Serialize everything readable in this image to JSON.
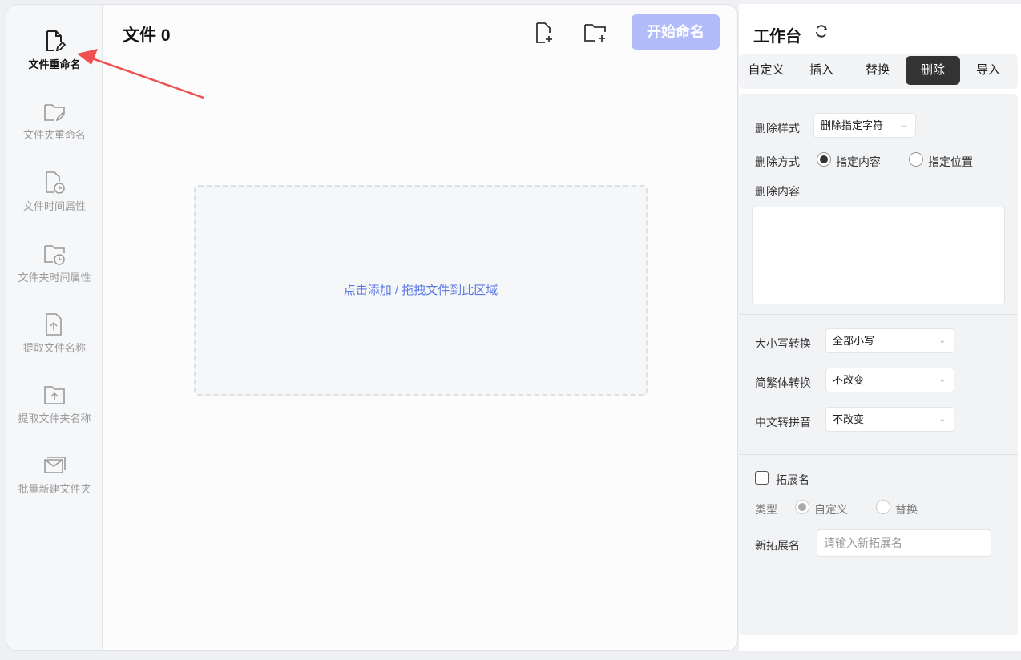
{
  "sidebar": {
    "items": [
      {
        "label": "文件重命名",
        "icon": "file-edit-icon",
        "active": true
      },
      {
        "label": "文件夹重命名",
        "icon": "folder-edit-icon"
      },
      {
        "label": "文件时间属性",
        "icon": "file-clock-icon"
      },
      {
        "label": "文件夹时间属性",
        "icon": "folder-clock-icon"
      },
      {
        "label": "提取文件名称",
        "icon": "file-upload-icon"
      },
      {
        "label": "提取文件夹名称",
        "icon": "folder-upload-icon"
      },
      {
        "label": "批量新建文件夹",
        "icon": "folders-icon"
      }
    ]
  },
  "main": {
    "title": "文件 0",
    "start_label": "开始命名",
    "drop_text": "点击添加 / 拖拽文件到此区域"
  },
  "workbench": {
    "title": "工作台",
    "tabs": [
      "自定义",
      "插入",
      "替换",
      "删除",
      "导入"
    ],
    "active_tab": "删除",
    "delete_style_label": "删除样式",
    "delete_style_value": "删除指定字符",
    "delete_mode_label": "删除方式",
    "mode_options": [
      "指定内容",
      "指定位置"
    ],
    "delete_content_label": "删除内容",
    "case_label": "大小写转换",
    "case_value": "全部小写",
    "trad_label": "简繁体转换",
    "trad_value": "不改变",
    "pinyin_label": "中文转拼音",
    "pinyin_value": "不改变",
    "ext_label": "拓展名",
    "type_label": "类型",
    "type_options": [
      "自定义",
      "替换"
    ],
    "new_ext_label": "新拓展名",
    "new_ext_placeholder": "请输入新拓展名"
  },
  "colors": {
    "accent": "#5a78e6",
    "start_button": "#b3bcfb",
    "arrow": "#f05050"
  }
}
